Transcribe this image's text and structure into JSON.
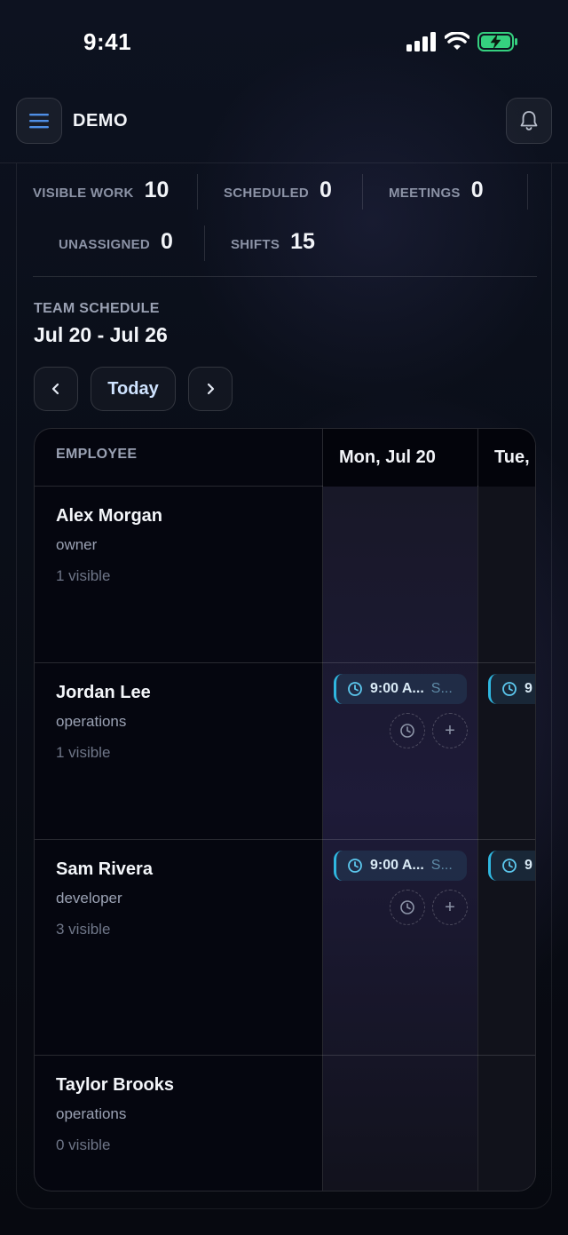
{
  "status_bar": {
    "time": "9:41"
  },
  "header": {
    "brand": "DEMO",
    "menu_icon": "menu-icon",
    "bell_icon": "bell-icon"
  },
  "stats": [
    {
      "label": "VISIBLE WORK",
      "value": "10"
    },
    {
      "label": "SCHEDULED",
      "value": "0"
    },
    {
      "label": "MEETINGS",
      "value": "0"
    },
    {
      "label": "UNASSIGNED",
      "value": "0"
    },
    {
      "label": "SHIFTS",
      "value": "15"
    }
  ],
  "schedule": {
    "section_label": "TEAM SCHEDULE",
    "range": "Jul 20 - Jul 26",
    "today_label": "Today",
    "employee_header": "EMPLOYEE",
    "days": [
      "Mon, Jul 20",
      "Tue,"
    ],
    "employees": [
      {
        "name": "Alex Morgan",
        "role": "owner",
        "visible": "1 visible"
      },
      {
        "name": "Jordan Lee",
        "role": "operations",
        "visible": "1 visible"
      },
      {
        "name": "Sam Rivera",
        "role": "developer",
        "visible": "3 visible"
      },
      {
        "name": "Taylor Brooks",
        "role": "operations",
        "visible": "0 visible"
      }
    ],
    "shift_chip": {
      "time": "9:00 A...",
      "sub": "S...",
      "time_partial": "9"
    },
    "add_label": "+"
  },
  "colors": {
    "accent": "#2fb7e0",
    "battery": "#35d07f",
    "menu_icon": "#4f8fe6"
  }
}
